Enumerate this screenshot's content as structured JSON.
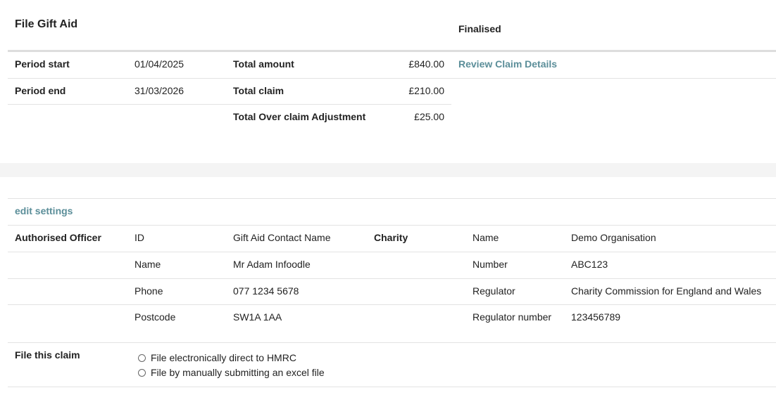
{
  "header": {
    "title": "File Gift Aid",
    "status": "Finalised"
  },
  "summary": {
    "period_start_label": "Period start",
    "period_start_value": "01/04/2025",
    "period_end_label": "Period end",
    "period_end_value": "31/03/2026",
    "total_amount_label": "Total amount",
    "total_amount_value": "£840.00",
    "total_claim_label": "Total claim",
    "total_claim_value": "£210.00",
    "over_claim_label": "Total Over claim Adjustment",
    "over_claim_value": "£25.00",
    "review_link": "Review Claim Details"
  },
  "settings": {
    "edit_link": "edit settings",
    "officer_heading": "Authorised Officer",
    "officer_rows": [
      {
        "label": "ID",
        "value": "Gift Aid Contact Name"
      },
      {
        "label": "Name",
        "value": "Mr Adam Infoodle"
      },
      {
        "label": "Phone",
        "value": "077 1234 5678"
      },
      {
        "label": "Postcode",
        "value": "SW1A 1AA"
      }
    ],
    "charity_heading": "Charity",
    "charity_rows": [
      {
        "label": "Name",
        "value": "Demo Organisation"
      },
      {
        "label": "Number",
        "value": "ABC123"
      },
      {
        "label": "Regulator",
        "value": "Charity Commission for England and Wales"
      },
      {
        "label": "Regulator number",
        "value": "123456789"
      }
    ]
  },
  "filing": {
    "label": "File this claim",
    "options": [
      "File electronically direct to HMRC",
      "File by manually submitting an excel file"
    ]
  }
}
